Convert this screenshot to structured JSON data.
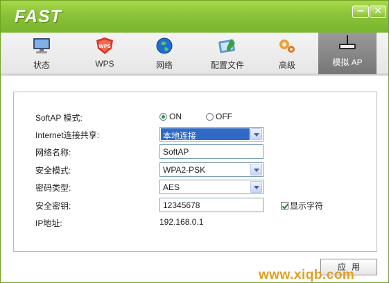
{
  "app": {
    "logo": "FAST"
  },
  "window_controls": {
    "minimize": "−",
    "close": "✕"
  },
  "tabs": [
    {
      "label": "状态",
      "icon": "monitor-icon",
      "active": false
    },
    {
      "label": "WPS",
      "icon": "wps-shield-icon",
      "active": false
    },
    {
      "label": "网络",
      "icon": "globe-icon",
      "active": false
    },
    {
      "label": "配置文件",
      "icon": "profile-card-icon",
      "active": false
    },
    {
      "label": "高级",
      "icon": "gears-icon",
      "active": false
    },
    {
      "label": "模拟 AP",
      "icon": "router-icon",
      "active": true
    }
  ],
  "form": {
    "softap_mode": {
      "label": "SoftAP 模式:",
      "options": [
        {
          "label": "ON",
          "checked": true
        },
        {
          "label": "OFF",
          "checked": false
        }
      ]
    },
    "internet_sharing": {
      "label": "Internet连接共享:",
      "value": "本地连接"
    },
    "network_name": {
      "label": "网络名称:",
      "value": "SoftAP"
    },
    "security_mode": {
      "label": "安全模式:",
      "value": "WPA2-PSK"
    },
    "cipher_type": {
      "label": "密码类型:",
      "value": "AES"
    },
    "security_key": {
      "label": "安全密钥:",
      "value": "12345678"
    },
    "show_chars": {
      "label": "显示字符",
      "checked": true
    },
    "ip_address": {
      "label": "IP地址:",
      "value": "192.168.0.1"
    }
  },
  "apply_button": {
    "label": "应用"
  },
  "watermark": "www.xiqb.com",
  "colors": {
    "titlebar": "#8cc43a",
    "selection": "#316ac5",
    "active_tab": "#8a8a8a",
    "watermark": "#e0a020"
  }
}
